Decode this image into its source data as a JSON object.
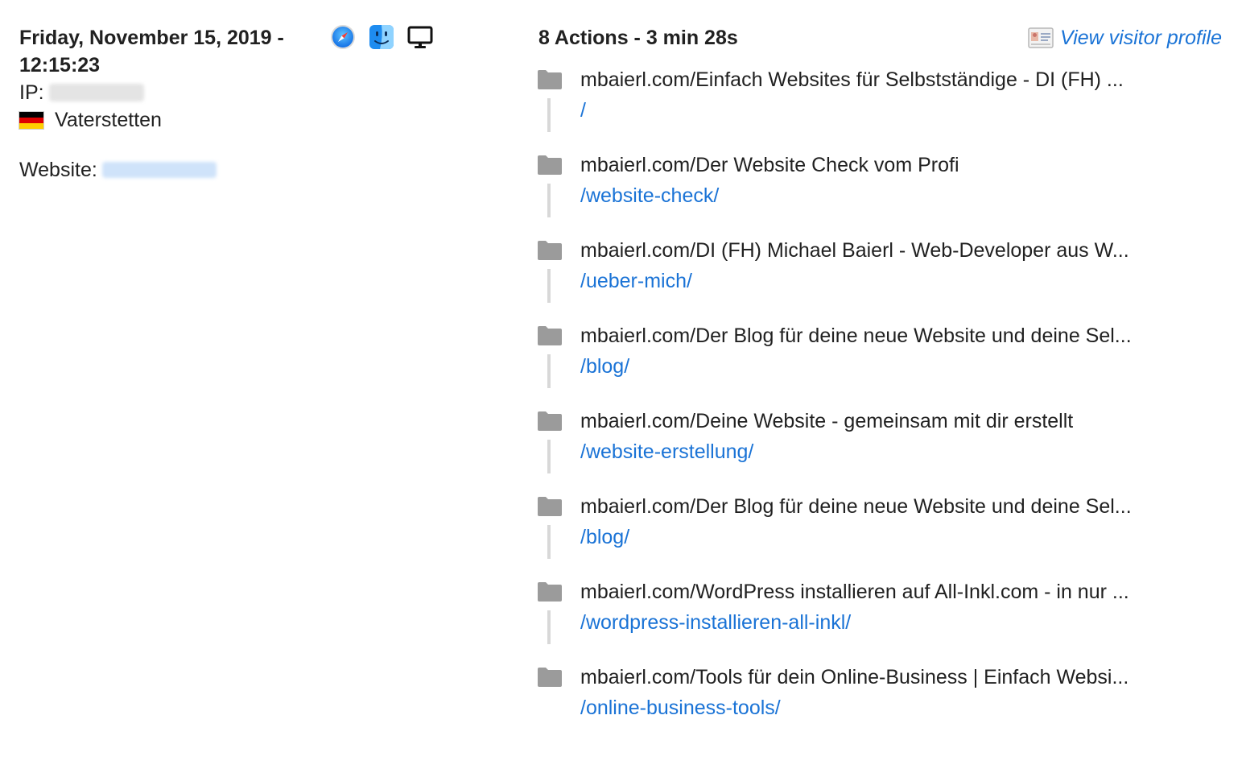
{
  "visit": {
    "datetime": "Friday, November 15, 2019 - 12:15:23",
    "ip_label": "IP:",
    "ip_value": "",
    "location": "Vaterstetten",
    "country_flag": "germany-flag-icon",
    "website_label": "Website:",
    "website_value": ""
  },
  "device": {
    "browser": "safari-icon",
    "os": "finder-icon",
    "device_type": "desktop-monitor-icon"
  },
  "actions": {
    "summary": "8 Actions - 3 min 28s",
    "visitor_profile_label": "View visitor profile",
    "items": [
      {
        "title": "mbaierl.com/Einfach Websites für Selbstständige - DI (FH) ...",
        "url": "/"
      },
      {
        "title": "mbaierl.com/Der Website Check vom Profi",
        "url": "/website-check/"
      },
      {
        "title": "mbaierl.com/DI (FH) Michael Baierl - Web-Developer aus W...",
        "url": "/ueber-mich/"
      },
      {
        "title": "mbaierl.com/Der Blog für deine neue Website und deine Sel...",
        "url": "/blog/"
      },
      {
        "title": "mbaierl.com/Deine Website - gemeinsam mit dir erstellt",
        "url": "/website-erstellung/"
      },
      {
        "title": "mbaierl.com/Der Blog für deine neue Website und deine Sel...",
        "url": "/blog/"
      },
      {
        "title": "mbaierl.com/WordPress installieren auf All-Inkl.com - in nur ...",
        "url": "/wordpress-installieren-all-inkl/"
      },
      {
        "title": "mbaierl.com/Tools für dein Online-Business | Einfach Websi...",
        "url": "/online-business-tools/"
      }
    ]
  },
  "colors": {
    "link": "#1a73d6",
    "text": "#212121",
    "folder": "#9b9b9b",
    "connector": "#d8d8d8"
  }
}
